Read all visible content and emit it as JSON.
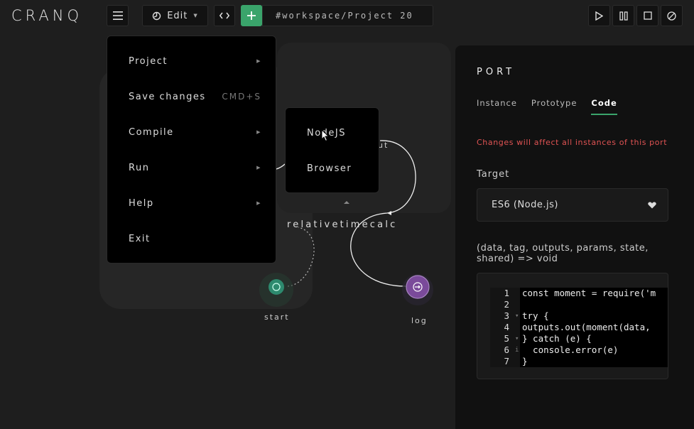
{
  "app": {
    "logo": "CRANQ",
    "edit_label": "Edit",
    "workspace_path": "#workspace/Project 20"
  },
  "colors": {
    "accent": "#3aa46b",
    "warning": "#e05353",
    "log_node": "#7a4a9a",
    "start_node": "#2d8a6e"
  },
  "toolbar": {
    "icons": [
      "menu-icon",
      "edit-icon",
      "code-icon",
      "plus-icon",
      "play-icon",
      "pause-icon",
      "stop-icon",
      "disable-icon"
    ]
  },
  "main_menu": {
    "items": [
      {
        "label": "Project",
        "submenu": true
      },
      {
        "label": "Save changes",
        "shortcut": "CMD+S"
      },
      {
        "label": "Compile",
        "submenu": true
      },
      {
        "label": "Run",
        "submenu": true
      },
      {
        "label": "Help",
        "submenu": true
      },
      {
        "label": "Exit"
      }
    ]
  },
  "run_submenu": {
    "items": [
      {
        "label": "NodeJS"
      },
      {
        "label": "Browser"
      }
    ]
  },
  "canvas": {
    "node_title": "relativetimecalc",
    "nodes": [
      {
        "label": "start"
      },
      {
        "label": "log"
      }
    ],
    "partial_label": "ut"
  },
  "panel": {
    "title": "PORT",
    "tabs": [
      {
        "label": "Instance",
        "active": false
      },
      {
        "label": "Prototype",
        "active": false
      },
      {
        "label": "Code",
        "active": true
      }
    ],
    "warning": "Changes will affect all instances of this port",
    "target_label": "Target",
    "target_value": "ES6 (Node.js)",
    "signature": "(data, tag, outputs, params, state, shared) => void",
    "code_lines": [
      {
        "n": "1",
        "fold": "",
        "text": "const moment = require('m"
      },
      {
        "n": "2",
        "fold": "",
        "text": ""
      },
      {
        "n": "3",
        "fold": "▾",
        "text": "try {"
      },
      {
        "n": "4",
        "fold": "",
        "text": "outputs.out(moment(data,"
      },
      {
        "n": "5",
        "fold": "▾",
        "text": "} catch (e) {"
      },
      {
        "n": "6",
        "fold": "i",
        "text": "  console.error(e)"
      },
      {
        "n": "7",
        "fold": "",
        "text": "}"
      }
    ]
  }
}
